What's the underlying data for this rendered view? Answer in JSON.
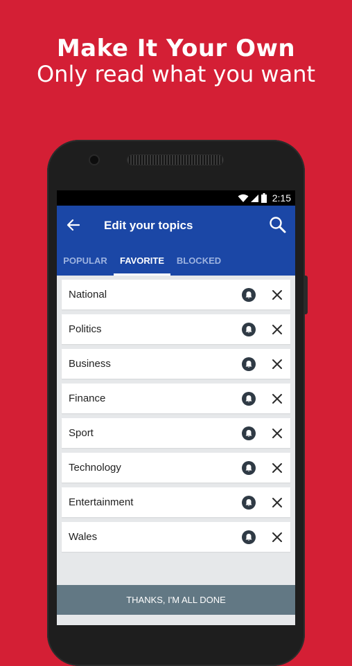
{
  "promo": {
    "title": "Make It Your Own",
    "subtitle": "Only read what you want"
  },
  "status_bar": {
    "time": "2:15",
    "icons": [
      "wifi-icon",
      "signal-icon",
      "battery-icon"
    ]
  },
  "app_bar": {
    "back_icon": "arrow-left-icon",
    "title": "Edit your topics",
    "search_icon": "search-icon"
  },
  "tabs": [
    {
      "label": "POPULAR",
      "active": false
    },
    {
      "label": "FAVORITE",
      "active": true
    },
    {
      "label": "BLOCKED",
      "active": false
    }
  ],
  "topics": [
    {
      "label": "National"
    },
    {
      "label": "Politics"
    },
    {
      "label": "Business"
    },
    {
      "label": "Finance"
    },
    {
      "label": "Sport"
    },
    {
      "label": "Technology"
    },
    {
      "label": "Entertainment"
    },
    {
      "label": "Wales"
    }
  ],
  "topic_actions": {
    "notify_icon": "bell-icon",
    "remove_icon": "close-icon"
  },
  "footer": {
    "done_label": "THANKS, I'M ALL DONE"
  },
  "colors": {
    "background": "#d41f35",
    "app_bar": "#1b47a6",
    "done_button": "#627884"
  }
}
